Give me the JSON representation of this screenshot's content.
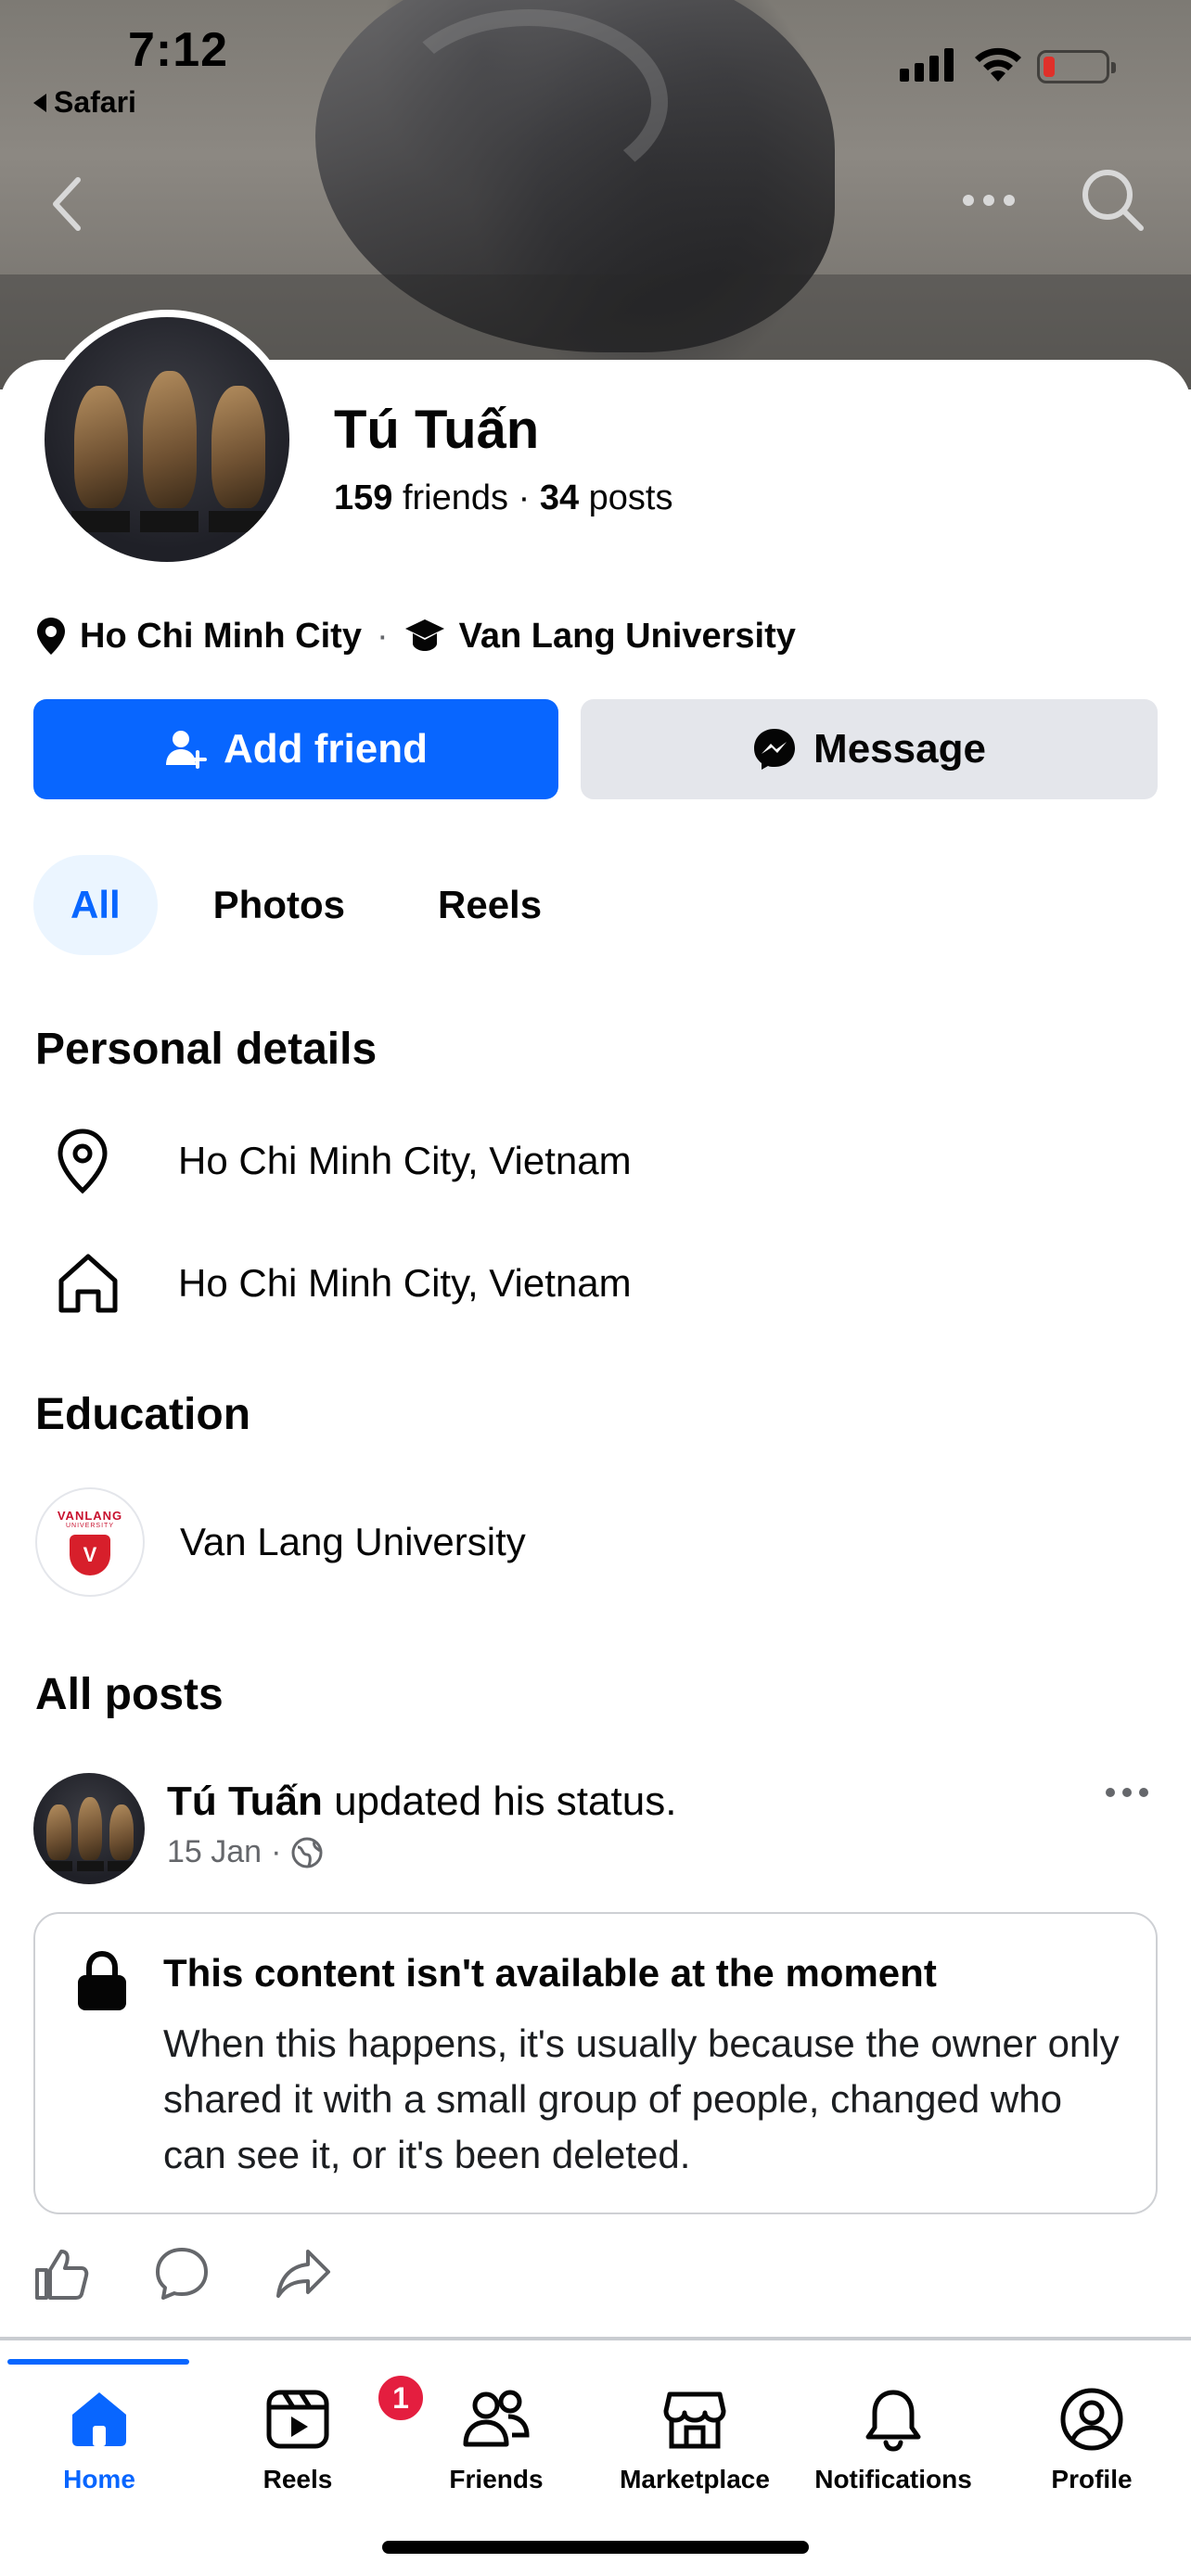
{
  "status_bar": {
    "time": "7:12",
    "back_app": "Safari"
  },
  "profile": {
    "name": "Tú Tuấn",
    "friends_count": "159",
    "friends_label": "friends",
    "posts_count": "34",
    "posts_label": "posts",
    "location_short": "Ho Chi Minh City",
    "school_short": "Van Lang University",
    "separator": "·"
  },
  "buttons": {
    "add_friend": "Add friend",
    "message": "Message"
  },
  "tabs": [
    "All",
    "Photos",
    "Reels"
  ],
  "personal_details": {
    "title": "Personal details",
    "current_city": "Ho Chi Minh City, Vietnam",
    "hometown": "Ho Chi Minh City, Vietnam"
  },
  "education": {
    "title": "Education",
    "school": "Van Lang University",
    "logo_text_top": "VANLANG",
    "logo_text_sub": "UNIVERSITY"
  },
  "posts": {
    "title": "All posts",
    "author": "Tú Tuấn",
    "action": "updated his status.",
    "date": "15 Jan",
    "meta_separator": "·",
    "locked_title": "This content isn't available at the moment",
    "locked_body": "When this happens, it's usually because the owner only shared it with a small group of people, changed who can see it, or it's been deleted."
  },
  "tabbar": {
    "items": [
      {
        "label": "Home",
        "icon": "home-icon",
        "active": true
      },
      {
        "label": "Reels",
        "icon": "reels-icon",
        "badge": "1"
      },
      {
        "label": "Friends",
        "icon": "friends-icon"
      },
      {
        "label": "Marketplace",
        "icon": "marketplace-icon"
      },
      {
        "label": "Notifications",
        "icon": "bell-icon"
      },
      {
        "label": "Profile",
        "icon": "profile-icon"
      }
    ]
  },
  "colors": {
    "primary": "#0866ff",
    "secondary_button": "#e4e6eb",
    "badge": "#e41e3f",
    "text": "#050505",
    "muted": "#65676b"
  }
}
